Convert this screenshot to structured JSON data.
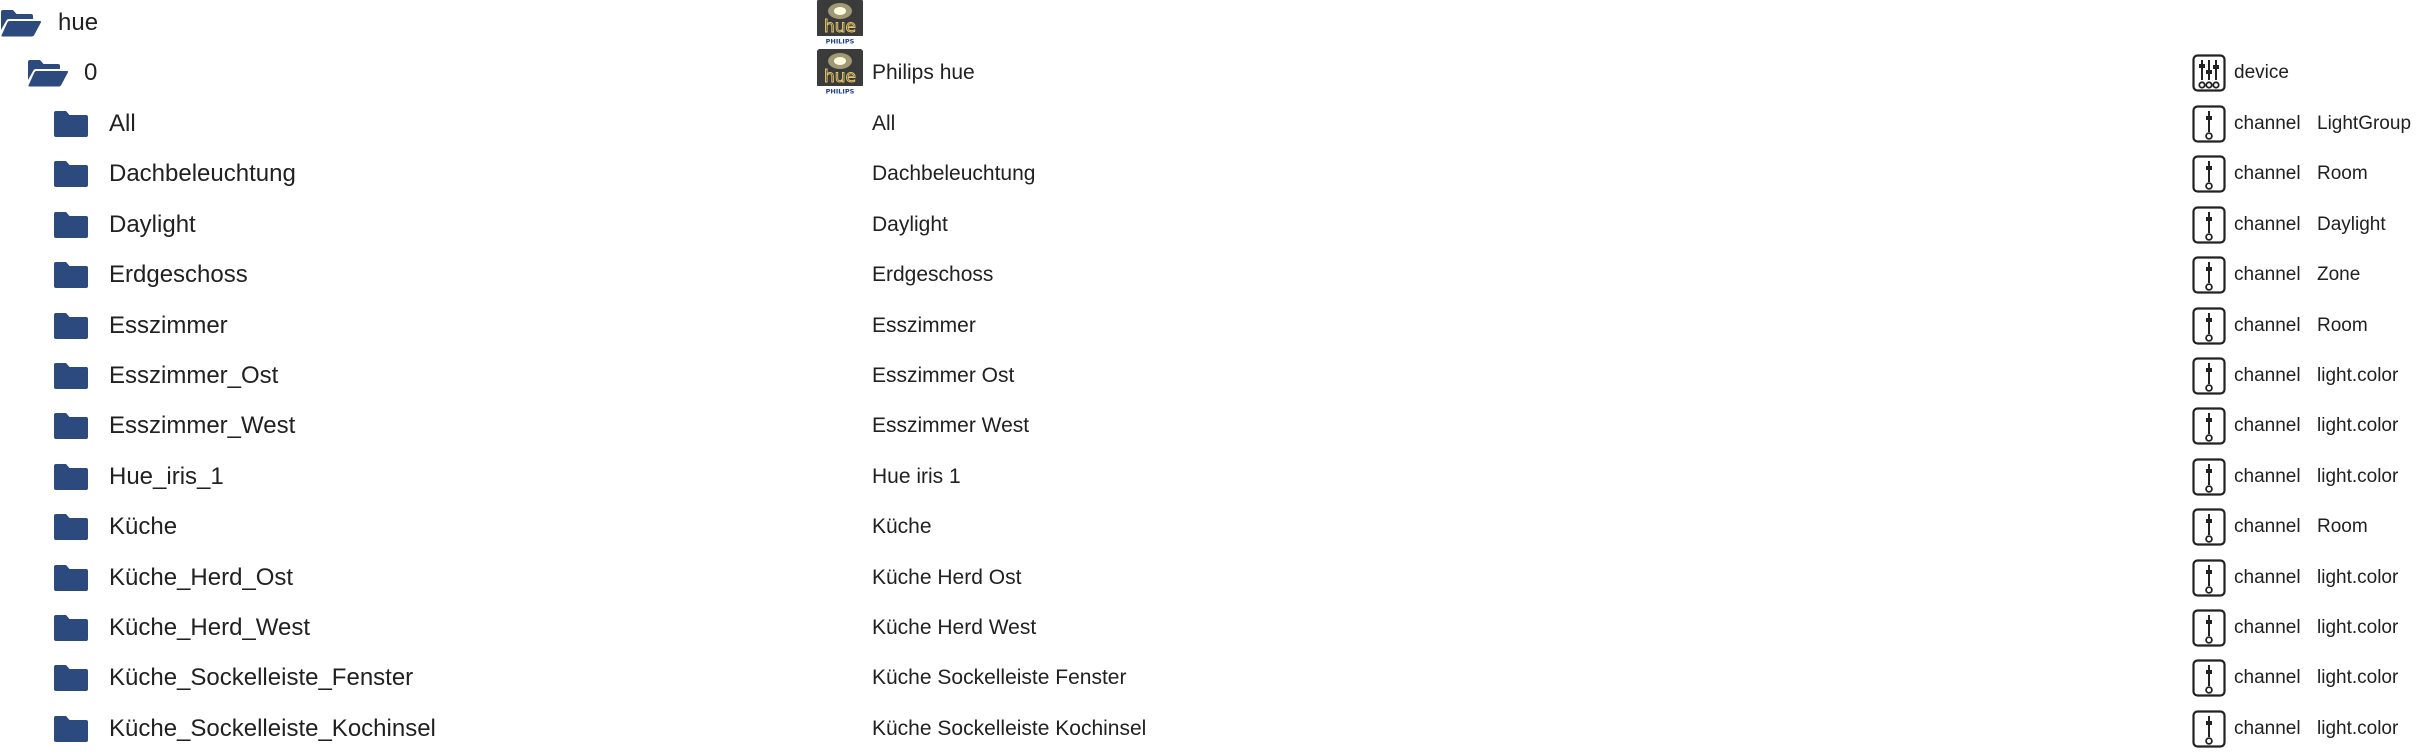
{
  "colors": {
    "folder": "#2c4a7e",
    "text": "#212121",
    "icon_stroke": "#222222"
  },
  "icons": {
    "open_folder": "folder-open-icon",
    "closed_folder": "folder-icon",
    "adapter": "hue-adapter-icon",
    "device": "device-icon",
    "channel": "channel-icon"
  },
  "root": {
    "name": "hue",
    "adapter_logo": {
      "word": "hue",
      "brand": "PHILIPS"
    }
  },
  "instance": {
    "name": "0",
    "title": "Philips hue",
    "type": "device",
    "adapter_logo": {
      "word": "hue",
      "brand": "PHILIPS"
    }
  },
  "channels": [
    {
      "name": "All",
      "title": "All",
      "type": "channel",
      "role": "LightGroup"
    },
    {
      "name": "Dachbeleuchtung",
      "title": "Dachbeleuchtung",
      "type": "channel",
      "role": "Room"
    },
    {
      "name": "Daylight",
      "title": "Daylight",
      "type": "channel",
      "role": "Daylight"
    },
    {
      "name": "Erdgeschoss",
      "title": "Erdgeschoss",
      "type": "channel",
      "role": "Zone"
    },
    {
      "name": "Esszimmer",
      "title": "Esszimmer",
      "type": "channel",
      "role": "Room"
    },
    {
      "name": "Esszimmer_Ost",
      "title": "Esszimmer Ost",
      "type": "channel",
      "role": "light.color"
    },
    {
      "name": "Esszimmer_West",
      "title": "Esszimmer West",
      "type": "channel",
      "role": "light.color"
    },
    {
      "name": "Hue_iris_1",
      "title": "Hue iris 1",
      "type": "channel",
      "role": "light.color"
    },
    {
      "name": "Küche",
      "title": "Küche",
      "type": "channel",
      "role": "Room"
    },
    {
      "name": "Küche_Herd_Ost",
      "title": "Küche Herd Ost",
      "type": "channel",
      "role": "light.color"
    },
    {
      "name": "Küche_Herd_West",
      "title": "Küche Herd West",
      "type": "channel",
      "role": "light.color"
    },
    {
      "name": "Küche_Sockelleiste_Fenster",
      "title": "Küche Sockelleiste Fenster",
      "type": "channel",
      "role": "light.color"
    },
    {
      "name": "Küche_Sockelleiste_Kochinsel",
      "title": "Küche Sockelleiste Kochinsel",
      "type": "channel",
      "role": "light.color"
    }
  ]
}
